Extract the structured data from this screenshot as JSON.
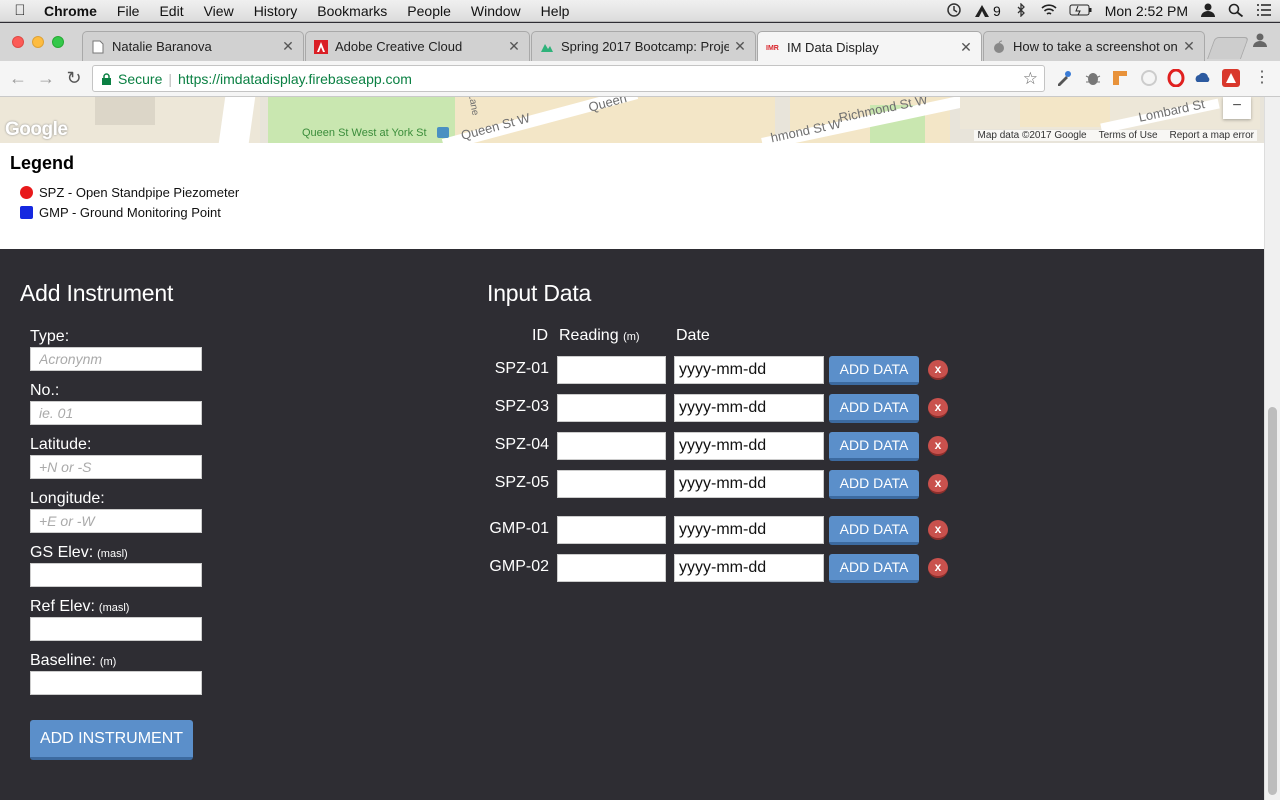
{
  "menubar": {
    "app": "Chrome",
    "items": [
      "File",
      "Edit",
      "View",
      "History",
      "Bookmarks",
      "People",
      "Window",
      "Help"
    ],
    "adobe_count": "9",
    "clock": "Mon 2:52 PM"
  },
  "tabs": [
    {
      "label": "Natalie Baranova",
      "icon": "document-icon"
    },
    {
      "label": "Adobe Creative Cloud",
      "icon": "adobe-icon"
    },
    {
      "label": "Spring 2017 Bootcamp: Proje",
      "icon": "bootcamp-icon"
    },
    {
      "label": "IM Data Display",
      "icon": "imr-icon",
      "active": true
    },
    {
      "label": "How to take a screenshot on y",
      "icon": "apple-icon"
    }
  ],
  "toolbar": {
    "secure_label": "Secure",
    "url": "https://imdatadisplay.firebaseapp.com"
  },
  "map": {
    "streets": [
      "Queen St West at York St",
      "Queen St W",
      "Queen",
      "Richmond St W",
      "hmond St W",
      "Lombard St",
      "Lane"
    ],
    "brand": "Google",
    "footer": [
      "Map data ©2017 Google",
      "Terms of Use",
      "Report a map error"
    ],
    "zoom_out_label": "−"
  },
  "legend": {
    "title": "Legend",
    "items": [
      {
        "label": "SPZ - Open Standpipe Piezometer",
        "color": "#e8191b"
      },
      {
        "label": "GMP - Ground Monitoring Point",
        "color": "#1528e0"
      }
    ]
  },
  "add_instrument": {
    "title": "Add Instrument",
    "fields": [
      {
        "label": "Type:",
        "unit": "",
        "placeholder": "Acronynm"
      },
      {
        "label": "No.:",
        "unit": "",
        "placeholder": "ie. 01"
      },
      {
        "label": "Latitude:",
        "unit": "",
        "placeholder": "+N or -S"
      },
      {
        "label": "Longitude:",
        "unit": "",
        "placeholder": "+E or -W"
      },
      {
        "label": "GS Elev:",
        "unit": "(masl)",
        "placeholder": ""
      },
      {
        "label": "Ref Elev:",
        "unit": "(masl)",
        "placeholder": ""
      },
      {
        "label": "Baseline:",
        "unit": "(m)",
        "placeholder": ""
      }
    ],
    "button": "ADD INSTRUMENT"
  },
  "input_data": {
    "title": "Input Data",
    "col_id": "ID",
    "col_reading": "Reading",
    "col_reading_unit": "(m)",
    "col_date": "Date",
    "rows": [
      {
        "id": "SPZ-01",
        "reading": "",
        "date": "yyyy-mm-dd",
        "button": "ADD DATA",
        "delete": "x"
      },
      {
        "id": "SPZ-03",
        "reading": "",
        "date": "yyyy-mm-dd",
        "button": "ADD DATA",
        "delete": "x"
      },
      {
        "id": "SPZ-04",
        "reading": "",
        "date": "yyyy-mm-dd",
        "button": "ADD DATA",
        "delete": "x"
      },
      {
        "id": "SPZ-05",
        "reading": "",
        "date": "yyyy-mm-dd",
        "button": "ADD DATA",
        "delete": "x"
      },
      {
        "id": "GMP-01",
        "reading": "",
        "date": "yyyy-mm-dd",
        "button": "ADD DATA",
        "delete": "x"
      },
      {
        "id": "GMP-02",
        "reading": "",
        "date": "yyyy-mm-dd",
        "button": "ADD DATA",
        "delete": "x"
      }
    ]
  },
  "colors": {
    "page_bg": "#2e2d33",
    "button_blue": "#5b8fca",
    "delete_red": "#c9514d",
    "secure_green": "#0b8043"
  }
}
